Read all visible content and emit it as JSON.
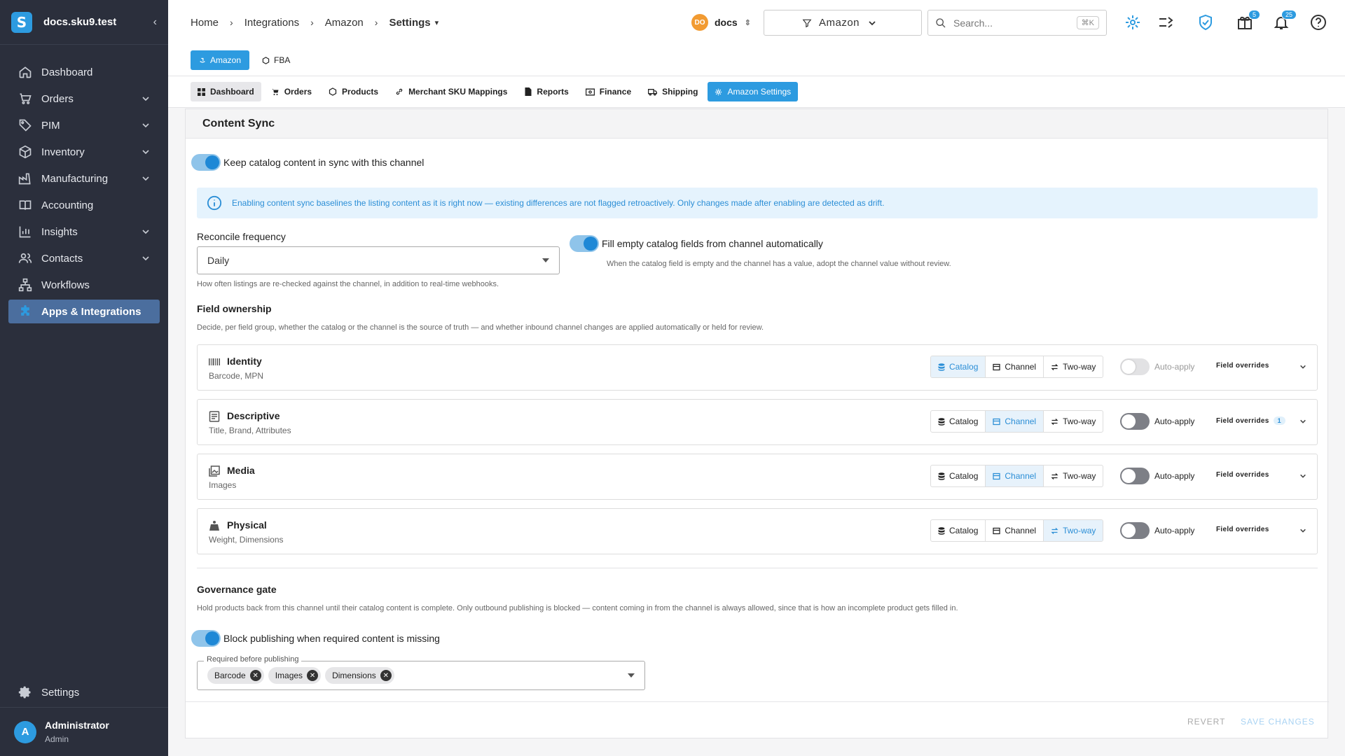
{
  "app": {
    "workspace": "docs.sku9.test"
  },
  "sidebar": {
    "items": [
      {
        "label": "Dashboard",
        "icon": "home-icon"
      },
      {
        "label": "Orders",
        "icon": "cart-icon"
      },
      {
        "label": "PIM",
        "icon": "tag-icon"
      },
      {
        "label": "Inventory",
        "icon": "box-icon"
      },
      {
        "label": "Manufacturing",
        "icon": "factory-icon"
      },
      {
        "label": "Accounting",
        "icon": "book-icon"
      },
      {
        "label": "Insights",
        "icon": "chart-icon"
      },
      {
        "label": "Contacts",
        "icon": "people-icon"
      },
      {
        "label": "Workflows",
        "icon": "sitemap-icon"
      },
      {
        "label": "Apps & Integrations",
        "icon": "puzzle-icon"
      }
    ],
    "settings": "Settings",
    "user": {
      "initial": "A",
      "name": "Administrator",
      "role": "Admin"
    }
  },
  "topbar": {
    "breadcrumbs": [
      "Home",
      "Integrations",
      "Amazon",
      "Settings"
    ],
    "org": {
      "initials": "DO",
      "name": "docs"
    },
    "channel": "Amazon",
    "search_placeholder": "Search...",
    "search_shortcut": "⌘K",
    "gift_badge": "5",
    "bell_badge": "25"
  },
  "subnav": {
    "pills": [
      "Amazon",
      "FBA"
    ]
  },
  "tabs": [
    "Dashboard",
    "Orders",
    "Products",
    "Merchant SKU Mappings",
    "Reports",
    "Finance",
    "Shipping",
    "Amazon Settings"
  ],
  "content": {
    "title": "Content Sync",
    "sync_toggle": "Keep catalog content in sync with this channel",
    "info": "Enabling content sync baselines the listing content as it is right now — existing differences are not flagged retroactively. Only changes made after enabling are detected as drift.",
    "reconcile_label": "Reconcile frequency",
    "reconcile_value": "Daily",
    "reconcile_help": "How often listings are re-checked against the channel, in addition to real-time webhooks.",
    "fill_toggle": "Fill empty catalog fields from channel automatically",
    "fill_help": "When the catalog field is empty and the channel has a value, adopt the channel value without review.",
    "ownership_title": "Field ownership",
    "ownership_help": "Decide, per field group, whether the catalog or the channel is the source of truth — and whether inbound channel changes are applied automatically or held for review.",
    "segment_labels": [
      "Catalog",
      "Channel",
      "Two-way"
    ],
    "auto_apply": "Auto-apply",
    "field_overrides": "Field overrides",
    "groups": [
      {
        "title": "Identity",
        "sub": "Barcode, MPN",
        "icon": "barcode-icon",
        "selected": "Catalog",
        "auto": "disabled",
        "overrides": ""
      },
      {
        "title": "Descriptive",
        "sub": "Title, Brand, Attributes",
        "icon": "document-icon",
        "selected": "Channel",
        "auto": "off",
        "overrides": "1"
      },
      {
        "title": "Media",
        "sub": "Images",
        "icon": "images-icon",
        "selected": "Channel",
        "auto": "off",
        "overrides": ""
      },
      {
        "title": "Physical",
        "sub": "Weight, Dimensions",
        "icon": "weight-icon",
        "selected": "Two-way",
        "auto": "off",
        "overrides": ""
      }
    ],
    "governance_title": "Governance gate",
    "governance_help": "Hold products back from this channel until their catalog content is complete. Only outbound publishing is blocked — content coming in from the channel is always allowed, since that is how an incomplete product gets filled in.",
    "block_toggle": "Block publishing when required content is missing",
    "required_label": "Required before publishing",
    "required_chips": [
      "Barcode",
      "Images",
      "Dimensions"
    ],
    "revert": "REVERT",
    "save": "SAVE CHANGES"
  },
  "colors": {
    "sidebar": "#2b2f3c",
    "accent": "#2d9be0",
    "active_nav": "#4b6e9e",
    "info_bg": "#e5f3fd"
  }
}
